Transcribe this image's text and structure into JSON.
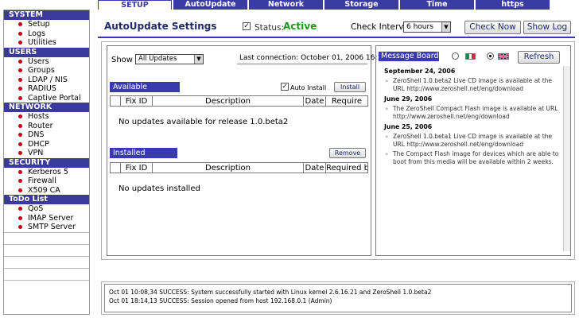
{
  "sidebar": {
    "sections": [
      {
        "title": "SYSTEM",
        "items": [
          "Setup",
          "Logs",
          "Utilities"
        ]
      },
      {
        "title": "USERS",
        "items": [
          "Users",
          "Groups",
          "LDAP / NIS",
          "RADIUS",
          "Captive Portal"
        ]
      },
      {
        "title": "NETWORK",
        "items": [
          "Hosts",
          "Router",
          "DNS",
          "DHCP",
          "VPN"
        ]
      },
      {
        "title": "SECURITY",
        "items": [
          "Kerberos 5",
          "Firewall",
          "X509 CA"
        ]
      },
      {
        "title": "ToDo List",
        "items": [
          "QoS",
          "IMAP Server",
          "SMTP Server"
        ]
      }
    ]
  },
  "tabs": [
    "SETUP",
    "AutoUpdate",
    "Network",
    "Storage",
    "Time",
    "https"
  ],
  "header": {
    "title": "AutoUpdate Settings",
    "status_label": "Status:",
    "status_value": "Active",
    "interval_label": "Check Interval",
    "interval_value": "6 hours",
    "check_now": "Check Now",
    "show_log": "Show Log"
  },
  "left": {
    "show_label": "Show",
    "show_value": "All Updates",
    "last_connection": "Last connection: October 01, 2006 16:18",
    "available_title": "Available Updates",
    "auto_install": "Auto Install",
    "install_btn": "Install",
    "available_cols": [
      "Fix ID",
      "Description",
      "Date",
      "Require"
    ],
    "available_empty": "No updates available for release 1.0.beta2",
    "installed_title": "Installed Updates",
    "remove_btn": "Remove",
    "installed_cols": [
      "Fix ID",
      "Description",
      "Date",
      "Required by"
    ],
    "installed_empty": "No updates installed"
  },
  "message_board": {
    "title": "Message Board",
    "refresh": "Refresh",
    "entries": [
      {
        "date": "September 24, 2006",
        "messages": [
          "ZeroShell 1.0.beta2 Live CD image is available at the URL http://www.zeroshell.net/eng/download"
        ]
      },
      {
        "date": "June 29, 2006",
        "messages": [
          "The ZeroShell Compact Flash image is available at URL http://www.zeroshell.net/eng/download"
        ]
      },
      {
        "date": "June 25, 2006",
        "messages": [
          "ZeroShell 1.0.beta1 Live CD image is available at the URL http://www.zeroshell.net/eng/download",
          "The Compact Flash image for devices which are able to boot from this media will be available within 2 weeks."
        ]
      }
    ]
  },
  "log": [
    "Oct 01 10:08,34 SUCCESS: System successfully started with Linux kernel 2.6.16.21 and ZeroShell 1.0.beta2",
    "Oct 01 18:14,13 SUCCESS: Session opened from host 192.168.0.1 (Admin)"
  ],
  "colors": {
    "accent": "#3b3ba4",
    "status_active": "#1a9a1a",
    "bullet": "#c8001a"
  }
}
